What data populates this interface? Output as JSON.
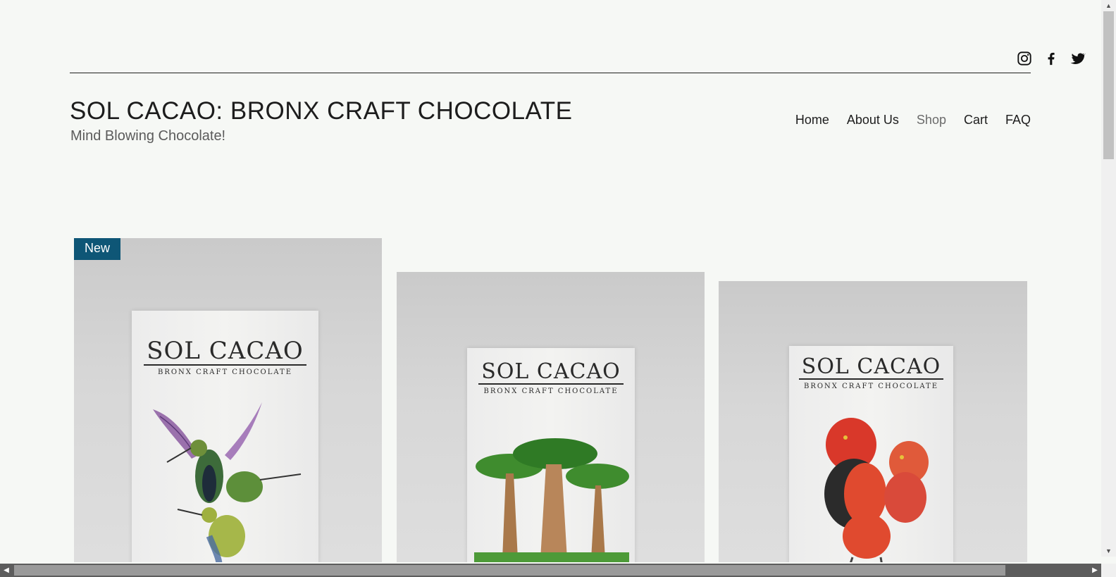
{
  "header": {
    "title": "SOL CACAO: BRONX CRAFT CHOCOLATE",
    "tagline": "Mind Blowing Chocolate!"
  },
  "social": [
    {
      "icon": "instagram-icon"
    },
    {
      "icon": "facebook-icon"
    },
    {
      "icon": "twitter-icon"
    }
  ],
  "nav": {
    "items": [
      {
        "label": "Home"
      },
      {
        "label": "About Us"
      },
      {
        "label": "Shop",
        "active": true
      },
      {
        "label": "Cart"
      },
      {
        "label": "FAQ"
      }
    ]
  },
  "products": [
    {
      "badge": "New",
      "brand": "SOL CACAO",
      "brand_sub": "BRONX CRAFT CHOCOLATE",
      "art": "hummingbirds"
    },
    {
      "brand": "SOL CACAO",
      "brand_sub": "BRONX CRAFT CHOCOLATE",
      "art": "baobab-trees"
    },
    {
      "brand": "SOL CACAO",
      "brand_sub": "BRONX CRAFT CHOCOLATE",
      "art": "red-birds"
    }
  ],
  "colors": {
    "background": "#f6f8f5",
    "badge": "#0e5676",
    "text": "#1d1d1d",
    "nav_active": "#6b6b6b"
  }
}
